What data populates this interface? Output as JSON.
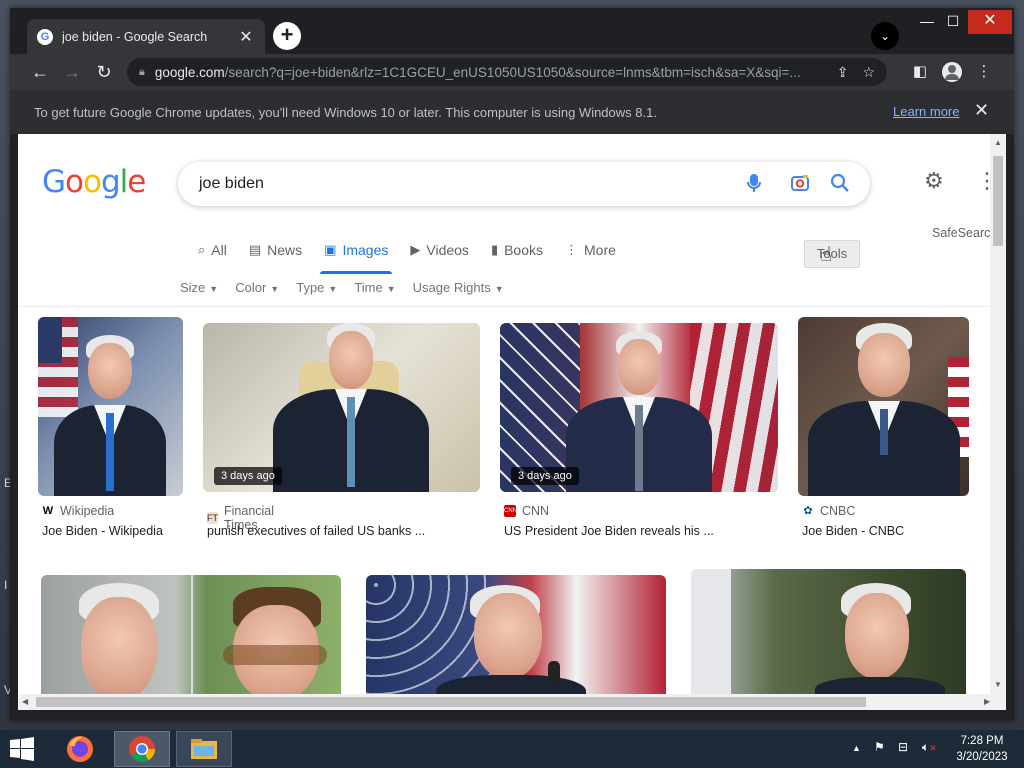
{
  "browser": {
    "tab_title": "joe biden - Google Search",
    "tab_favicon": "google-favicon",
    "url_host": "google.com",
    "url_rest": "/search?q=joe+biden&rlz=1C1GCEU_enUS1050US1050&source=lnms&tbm=isch&sa=X&sqi=...",
    "infobar_text": "To get future Google Chrome updates, you'll need Windows 10 or later. This computer is using Windows 8.1.",
    "infobar_link": "Learn more"
  },
  "google": {
    "logo_letters": [
      "G",
      "o",
      "o",
      "g",
      "l",
      "e"
    ],
    "logo_colors": [
      "#4285f4",
      "#ea4335",
      "#fbbc05",
      "#4285f4",
      "#34a853",
      "#ea4335"
    ],
    "query": "joe biden",
    "safesearch": "SafeSearch",
    "tools_label": "Tools"
  },
  "tabs": [
    {
      "label": "All",
      "icon": "search-icon",
      "active": false
    },
    {
      "label": "News",
      "icon": "news-icon",
      "active": false
    },
    {
      "label": "Images",
      "icon": "image-icon",
      "active": true
    },
    {
      "label": "Videos",
      "icon": "video-icon",
      "active": false
    },
    {
      "label": "Books",
      "icon": "book-icon",
      "active": false
    },
    {
      "label": "More",
      "icon": "more-dots-icon",
      "active": false
    }
  ],
  "filters": [
    "Size",
    "Color",
    "Type",
    "Time",
    "Usage Rights"
  ],
  "results": [
    {
      "source": "Wikipedia",
      "caption": "Joe Biden - Wikipedia",
      "badge": "",
      "fav_color": "#000000"
    },
    {
      "source": "Financial Times",
      "caption": "punish executives of failed US banks ...",
      "badge": "3 days ago",
      "fav_color": "#f2dfce"
    },
    {
      "source": "CNN",
      "caption": "US President Joe Biden reveals his ...",
      "badge": "3 days ago",
      "fav_color": "#cc0000"
    },
    {
      "source": "CNBC",
      "caption": "Joe Biden - CNBC",
      "badge": "",
      "fav_color": "#005594"
    }
  ],
  "taskbar": {
    "time": "7:28 PM",
    "date": "3/20/2023"
  }
}
